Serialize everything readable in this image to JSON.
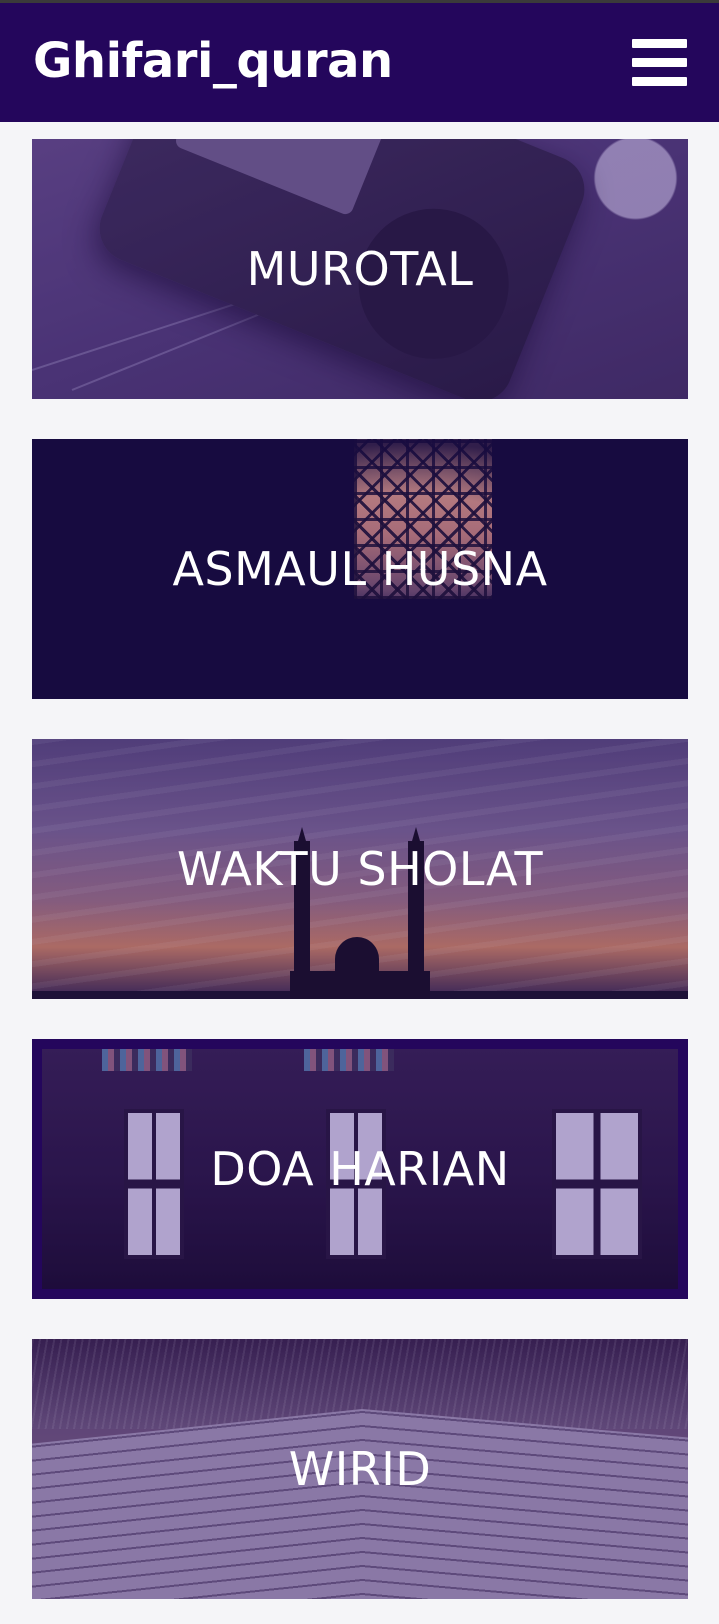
{
  "app": {
    "title": "Ghifari_quran",
    "menu_icon": "hamburger-menu-icon"
  },
  "menu_cards": [
    {
      "id": "murotal",
      "label": "MUROTAL"
    },
    {
      "id": "asmaul-husna",
      "label": "ASMAUL HUSNA"
    },
    {
      "id": "waktu-sholat",
      "label": "WAKTU SHOLAT"
    },
    {
      "id": "doa-harian",
      "label": "DOA HARIAN"
    },
    {
      "id": "wirid",
      "label": "WIRID"
    }
  ],
  "colors": {
    "app_bar": "#24065c",
    "page_background": "#f5f5f8",
    "label_text": "#ffffff"
  }
}
